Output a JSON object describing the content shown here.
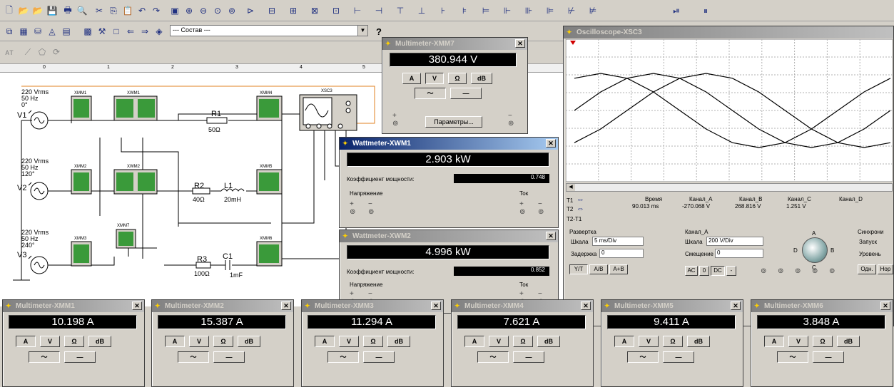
{
  "toolbar": {
    "component_combo": "--- Состав ---",
    "help": "?"
  },
  "circuit": {
    "v1": {
      "label": "V1",
      "rms": "220 Vrms",
      "freq": "50 Hz",
      "phase": "0°"
    },
    "v2": {
      "label": "V2",
      "rms": "220 Vrms",
      "freq": "50 Hz",
      "phase": "120°"
    },
    "v3": {
      "label": "V3",
      "rms": "220 Vrms",
      "freq": "50 Hz",
      "phase": "240°"
    },
    "r1": {
      "label": "R1",
      "value": "50Ω"
    },
    "r2": {
      "label": "R2",
      "value": "40Ω"
    },
    "l1": {
      "label": "L1",
      "value": "20mH"
    },
    "r3": {
      "label": "R3",
      "value": "100Ω"
    },
    "c1": {
      "label": "C1",
      "value": "1mF"
    },
    "meters": [
      "XMM1",
      "XMM2",
      "XMM3",
      "XMM4",
      "XMM5",
      "XMM6",
      "XMM7",
      "XWM1",
      "XWM2",
      "XSC3"
    ]
  },
  "mm7": {
    "title": "Multimeter-XMM7",
    "reading": "380.944 V",
    "params": "Параметры..."
  },
  "wm1": {
    "title": "Wattmeter-XWM1",
    "reading": "2.903 kW",
    "pf_label": "Коэффициент мощности:",
    "pf": "0.748",
    "voltage": "Напряжение",
    "current": "Ток"
  },
  "wm2": {
    "title": "Wattmeter-XWM2",
    "reading": "4.996 kW",
    "pf_label": "Коэффициент мощности:",
    "pf": "0.852",
    "voltage": "Напряжение",
    "current": "Ток"
  },
  "scope": {
    "title": "Oscilloscope-XSC3",
    "time_label": "Время",
    "chA_label": "Канал_A",
    "chB_label": "Канал_B",
    "chC_label": "Канал_C",
    "chD_label": "Канал_D",
    "t1_time": "90.013 ms",
    "t1_a": "-270.068 V",
    "t1_b": "268.816 V",
    "t1_c": "1.251 V",
    "sweep_label": "Развертка",
    "scale_label": "Шкала",
    "scale_value": "5 ms/Div",
    "delay_label": "Задержка",
    "delay_value": "0",
    "ch_section": "Канал_A",
    "ch_scale_label": "Шкала",
    "ch_scale_value": "200 V/Div",
    "offset_label": "Смещение",
    "offset_value": "0",
    "sync_label": "Синхрони",
    "trigger_label": "Запуск",
    "level_label": "Уровень",
    "btn_yt": "Y/T",
    "btn_ab": "A/B",
    "btn_apb": "A+B",
    "btn_ac": "AC",
    "btn_0": "0",
    "btn_dc": "DC",
    "btn_minus": "-",
    "btn_single": "Одн.",
    "btn_normal": "Нор",
    "t1": "T1",
    "t2": "T2",
    "t2t1": "T2-T1"
  },
  "chart_data": {
    "type": "line",
    "series": [
      {
        "values": [
          0,
          0.5,
          0.87,
          1,
          0.87,
          0.5,
          0,
          -0.5,
          -0.87,
          -1,
          -0.87,
          -0.5,
          0
        ]
      },
      {
        "values": [
          -0.87,
          -0.5,
          0,
          0.5,
          0.87,
          1,
          0.87,
          0.5,
          0,
          -0.5,
          -0.87,
          -1,
          -0.87
        ]
      },
      {
        "values": [
          0.87,
          1,
          0.87,
          0.5,
          0,
          -0.5,
          -0.87,
          -1,
          -0.87,
          -0.5,
          0,
          0.5,
          0.87
        ]
      }
    ]
  },
  "multimeters": [
    {
      "title": "Multimeter-XMM1",
      "reading": "10.198 A"
    },
    {
      "title": "Multimeter-XMM2",
      "reading": "15.387 A"
    },
    {
      "title": "Multimeter-XMM3",
      "reading": "11.294 A"
    },
    {
      "title": "Multimeter-XMM4",
      "reading": "7.621 A"
    },
    {
      "title": "Multimeter-XMM5",
      "reading": "9.411 A"
    },
    {
      "title": "Multimeter-XMM6",
      "reading": "3.848 A"
    }
  ],
  "mm_buttons": {
    "a": "A",
    "v": "V",
    "ohm": "Ω",
    "db": "dB"
  }
}
